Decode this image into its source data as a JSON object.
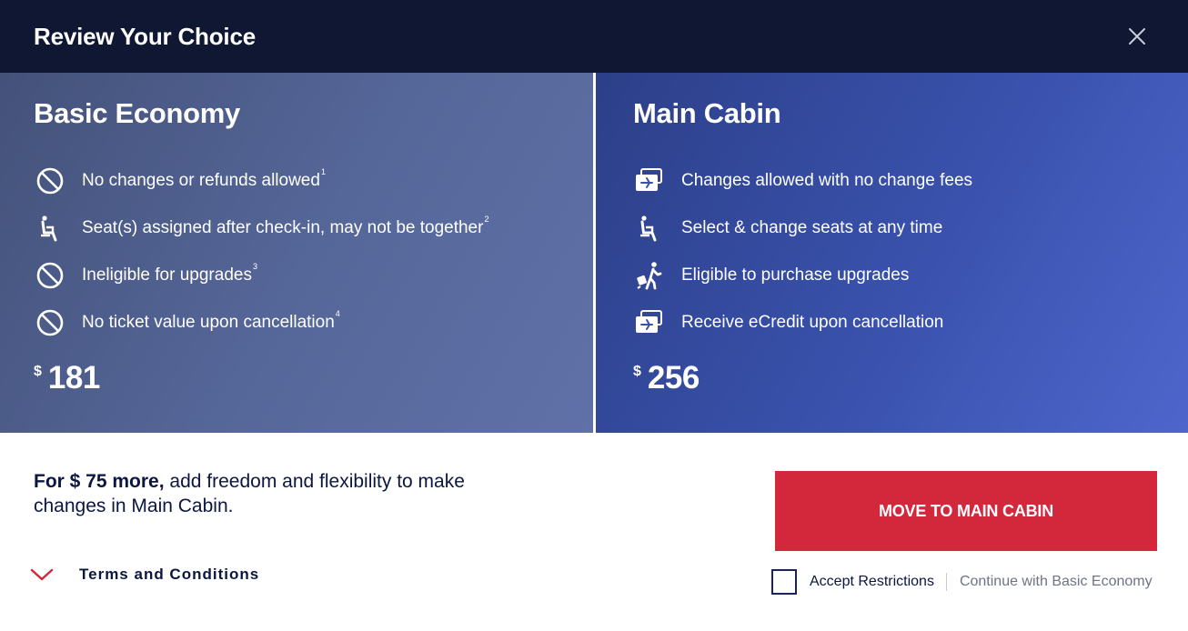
{
  "header": {
    "title": "Review Your Choice",
    "close_icon": "close-icon"
  },
  "basic": {
    "title": "Basic Economy",
    "features": [
      {
        "icon": "no-entry-icon",
        "text": "No changes or refunds allowed",
        "sup": "1"
      },
      {
        "icon": "seat-icon",
        "text": "Seat(s) assigned after check-in, may not be together",
        "sup": "2"
      },
      {
        "icon": "no-entry-icon",
        "text": "Ineligible for upgrades",
        "sup": "3"
      },
      {
        "icon": "no-entry-icon",
        "text": "No ticket value upon cancellation",
        "sup": "4"
      }
    ],
    "price_currency": "$",
    "price": "181"
  },
  "main": {
    "title": "Main Cabin",
    "features": [
      {
        "icon": "ticket-plane-icon",
        "text": "Changes allowed with no change fees"
      },
      {
        "icon": "seat-icon",
        "text": "Select & change seats at any time"
      },
      {
        "icon": "traveler-icon",
        "text": "Eligible to purchase upgrades"
      },
      {
        "icon": "ticket-plane-icon",
        "text": "Receive eCredit upon cancellation"
      }
    ],
    "price_currency": "$",
    "price": "256"
  },
  "upsell": {
    "strong": "For $ 75 more,",
    "rest": " add freedom and flexibility to make changes in Main Cabin."
  },
  "terms": {
    "label": "Terms and Conditions"
  },
  "cta": {
    "label": "MOVE TO MAIN CABIN"
  },
  "accept": {
    "label": "Accept Restrictions",
    "continue_label": "Continue with Basic Economy"
  },
  "colors": {
    "header_bg": "#101733",
    "cta_red": "#d3273b",
    "navy_text": "#0b1641"
  }
}
